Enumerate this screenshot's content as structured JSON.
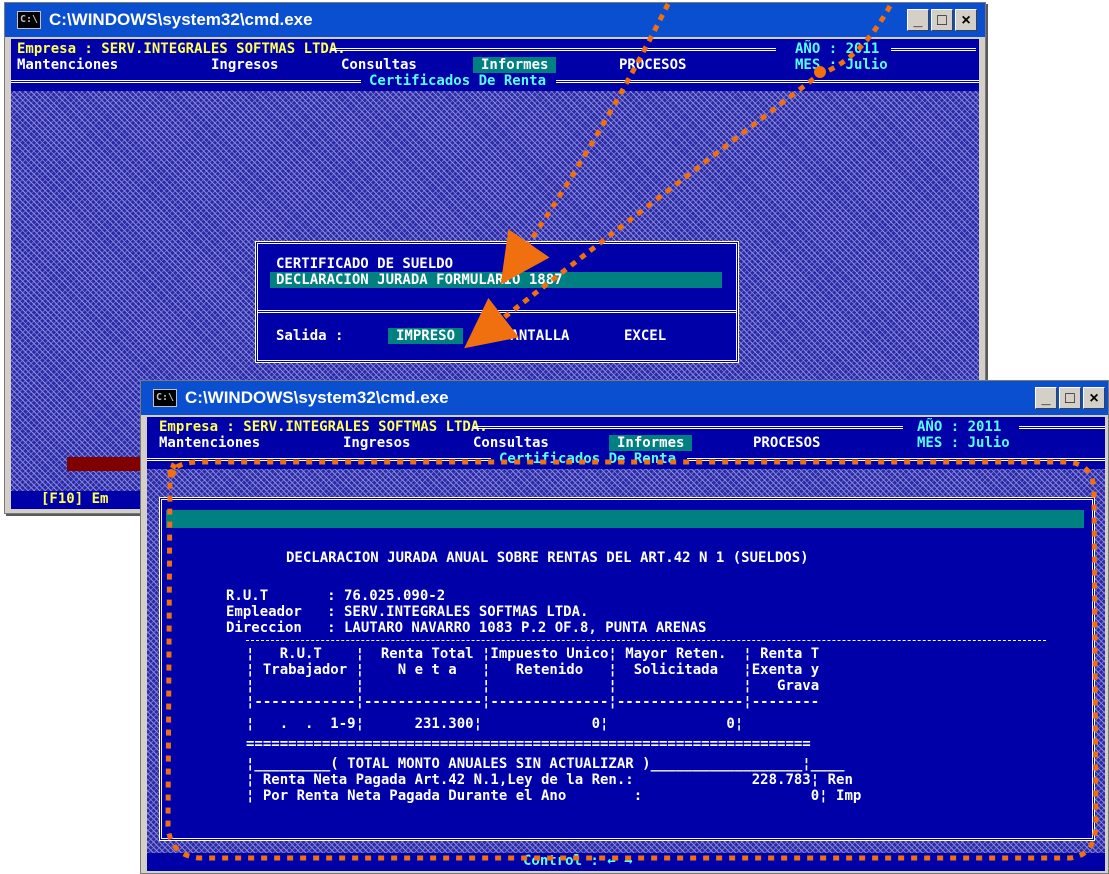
{
  "win1": {
    "title": "C:\\WINDOWS\\system32\\cmd.exe",
    "empresa_label": "Empresa : SERV.INTEGRALES SOFTMAS LTDA.",
    "ano": "AÑO : 2011",
    "mes": "MES : Julio",
    "menu": [
      "Mantenciones",
      "Ingresos",
      "Consultas",
      "Informes",
      "PROCESOS"
    ],
    "section_title": "Certificados De Renta",
    "options": [
      "CERTIFICADO DE SUELDO",
      "DECLARACION JURADA FORMULARIO 1887"
    ],
    "salida_label": "Salida :",
    "salida_options": [
      "IMPRESO",
      "PANTALLA",
      "EXCEL"
    ],
    "status_partial": "[F10] Em"
  },
  "win2": {
    "title": "C:\\WINDOWS\\system32\\cmd.exe",
    "empresa_label": "Empresa : SERV.INTEGRALES SOFTMAS LTDA.",
    "ano": "AÑO : 2011",
    "mes": "MES : Julio",
    "menu": [
      "Mantenciones",
      "Ingresos",
      "Consultas",
      "Informes",
      "PROCESOS"
    ],
    "section_title": "Certificados De Renta",
    "report_title": "DECLARACION JURADA ANUAL SOBRE RENTAS DEL ART.42 N 1 (SUELDOS)",
    "rut": "R.U.T       : 76.025.090-2",
    "empleador": "Empleador   : SERV.INTEGRALES SOFTMAS LTDA.",
    "direccion": "Direccion   : LAUTARO NAVARRO 1083 P.2 OF.8, PUNTA ARENAS",
    "table_header_1": "¦   R.U.T    ¦  Renta Total ¦Impuesto Unico¦ Mayor Reten.  ¦ Renta T",
    "table_header_2": "¦ Trabajador ¦    N e t a   ¦   Retenido   ¦  Solicitada   ¦Exenta y",
    "table_header_3": "¦            ¦              ¦              ¦               ¦   Grava",
    "table_sep": "¦------------¦--------------¦--------------¦---------------¦--------",
    "table_row": "¦   .  .  1-9¦      231.300¦             0¦              0¦",
    "eq_line": "===================================================================",
    "total_line": "¦_________( TOTAL MONTO ANUALES SIN ACTUALIZAR )__________________¦____",
    "renta_neta": "¦ Renta Neta Pagada Art.42 N.1,Ley de la Ren.:              228.783¦ Ren",
    "por_renta": "¦ Por Renta Neta Pagada Durante el Ano        :                    0¦ Imp",
    "control": "Control : ← →"
  },
  "colors": {
    "console_bg": "#0000a8",
    "accent": "#008080",
    "yellow": "#ffff55",
    "cyan": "#55ffff",
    "arrow": "#f07010"
  }
}
